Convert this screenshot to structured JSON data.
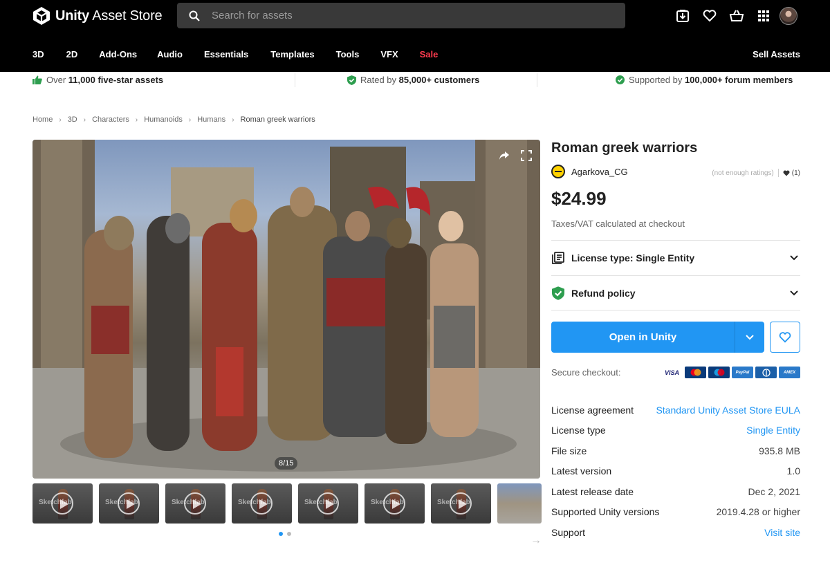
{
  "header": {
    "brand": "Unity",
    "brand_suffix": "Asset Store",
    "search_placeholder": "Search for assets",
    "icons": [
      "download-icon",
      "heart-icon",
      "basket-icon",
      "apps-grid-icon",
      "user-avatar"
    ],
    "nav": [
      {
        "label": "3D"
      },
      {
        "label": "2D"
      },
      {
        "label": "Add-Ons"
      },
      {
        "label": "Audio"
      },
      {
        "label": "Essentials"
      },
      {
        "label": "Templates"
      },
      {
        "label": "Tools"
      },
      {
        "label": "VFX"
      },
      {
        "label": "Sale",
        "color": "#ff3b4e"
      }
    ],
    "sell": "Sell Assets"
  },
  "trust": [
    {
      "pre": "Over ",
      "bold": "11,000 five-star assets",
      "post": ""
    },
    {
      "pre": "Rated by ",
      "bold": "85,000+ customers",
      "post": ""
    },
    {
      "pre": "Supported by ",
      "bold": "100,000+ forum members",
      "post": ""
    }
  ],
  "breadcrumb": [
    "Home",
    "3D",
    "Characters",
    "Humanoids",
    "Humans",
    "Roman greek warriors"
  ],
  "gallery": {
    "counter": "8/15",
    "thumb_label": "Sketchfab",
    "thumb_count": 8,
    "dots": 2,
    "active_dot": 0
  },
  "product": {
    "title": "Roman greek warriors",
    "publisher": "Agarkova_CG",
    "ratings_note": "(not enough ratings)",
    "favorites": "(1)",
    "price": "$24.99",
    "vat_note": "Taxes/VAT calculated at checkout",
    "license_accordion": "License type: Single Entity",
    "refund_accordion": "Refund policy",
    "open_button": "Open in Unity",
    "secure_checkout": "Secure checkout:",
    "cards": [
      {
        "name": "VISA",
        "bg": "#ffffff",
        "fg": "#1a1f71"
      },
      {
        "name": "MC",
        "bg": "#0a3a7a",
        "fg": "#ffffff"
      },
      {
        "name": "Maestro",
        "bg": "#0a3a7a",
        "fg": "#ffffff"
      },
      {
        "name": "PayPal",
        "bg": "#2a79c9",
        "fg": "#ffffff"
      },
      {
        "name": "Diners",
        "bg": "#1b5fa8",
        "fg": "#ffffff"
      },
      {
        "name": "AMEX",
        "bg": "#2a79c9",
        "fg": "#ffffff"
      }
    ]
  },
  "details": [
    {
      "key": "License agreement",
      "value": "Standard Unity Asset Store EULA",
      "link": true
    },
    {
      "key": "License type",
      "value": "Single Entity",
      "link": true
    },
    {
      "key": "File size",
      "value": "935.8 MB",
      "link": false
    },
    {
      "key": "Latest version",
      "value": "1.0",
      "link": false
    },
    {
      "key": "Latest release date",
      "value": "Dec 2, 2021",
      "link": false
    },
    {
      "key": "Supported Unity versions",
      "value": "2019.4.28 or higher",
      "link": false
    },
    {
      "key": "Support",
      "value": "Visit site",
      "link": true
    }
  ],
  "colors": {
    "accent": "#2196f3",
    "sale": "#ff3b4e",
    "header_bg": "#000000"
  }
}
